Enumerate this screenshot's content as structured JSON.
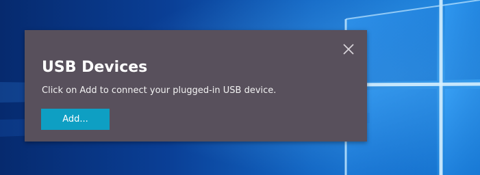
{
  "popup": {
    "title": "USB Devices",
    "message": "Click on Add to connect your plugged-in USB device.",
    "add_button_label": "Add...",
    "close_icon": "close-icon"
  },
  "colors": {
    "popup_background": "#58505c",
    "button_background": "#0e9fc3",
    "text": "#ffffff",
    "desktop_accent": "#1d86e0"
  }
}
